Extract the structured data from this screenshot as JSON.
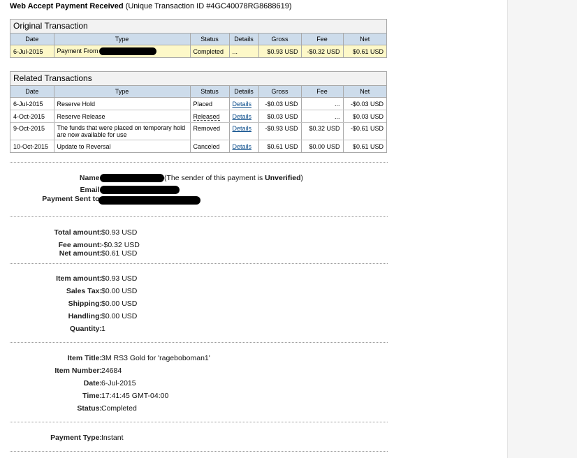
{
  "heading": {
    "title": "Web Accept Payment Received",
    "transaction_id": "(Unique Transaction ID #4GC40078RG8688619)"
  },
  "original": {
    "section_title": "Original Transaction",
    "headers": [
      "Date",
      "Type",
      "Status",
      "Details",
      "Gross",
      "Fee",
      "Net"
    ],
    "row": {
      "date": "6-Jul-2015",
      "type": "Payment From",
      "status": "Completed",
      "details": "...",
      "gross": "$0.93 USD",
      "fee": "-$0.32 USD",
      "net": "$0.61 USD"
    }
  },
  "related": {
    "section_title": "Related Transactions",
    "headers": [
      "Date",
      "Type",
      "Status",
      "Details",
      "Gross",
      "Fee",
      "Net"
    ],
    "rows": [
      {
        "date": "6-Jul-2015",
        "type": "Reserve Hold",
        "status": "Placed",
        "details": "Details",
        "gross": "-$0.03 USD",
        "fee": "...",
        "net": "-$0.03 USD"
      },
      {
        "date": "4-Oct-2015",
        "type": "Reserve Release",
        "status": "Released",
        "details": "Details",
        "gross": "$0.03 USD",
        "fee": "...",
        "net": "$0.03 USD"
      },
      {
        "date": "9-Oct-2015",
        "type": "The funds that were placed on temporary hold are now available for use",
        "status": "Removed",
        "details": "Details",
        "gross": "-$0.93 USD",
        "fee": "$0.32 USD",
        "net": "-$0.61 USD"
      },
      {
        "date": "10-Oct-2015",
        "type": "Update to Reversal",
        "status": "Canceled",
        "details": "Details",
        "gross": "$0.61 USD",
        "fee": "$0.00 USD",
        "net": "$0.61 USD"
      }
    ]
  },
  "sender": {
    "name_label": "Name:",
    "name_suffix": "(The sender of this payment is ",
    "verification": "Unverified",
    "name_suffix_end": ")",
    "email_label": "Email:",
    "sent_to_label": "Payment Sent to:"
  },
  "totals": {
    "total_label": "Total amount:",
    "total_value": "$0.93 USD",
    "fee_label": "Fee amount:",
    "fee_value": "-$0.32 USD",
    "net_label": "Net amount:",
    "net_value": "$0.61 USD"
  },
  "item_amounts": {
    "item_label": "Item amount:",
    "item_value": "$0.93 USD",
    "tax_label": "Sales Tax:",
    "tax_value": "$0.00 USD",
    "shipping_label": "Shipping:",
    "shipping_value": "$0.00 USD",
    "handling_label": "Handling:",
    "handling_value": "$0.00 USD",
    "quantity_label": "Quantity:",
    "quantity_value": "1"
  },
  "item_info": {
    "title_label": "Item Title:",
    "title_value": "3M RS3 Gold for 'rageboboman1'",
    "number_label": "Item Number:",
    "number_value": "24684",
    "date_label": "Date:",
    "date_value": "6-Jul-2015",
    "time_label": "Time:",
    "time_value": "17:41:45 GMT-04:00",
    "status_label": "Status:",
    "status_value": "Completed"
  },
  "payment": {
    "type_label": "Payment Type:",
    "type_value": "Instant"
  }
}
